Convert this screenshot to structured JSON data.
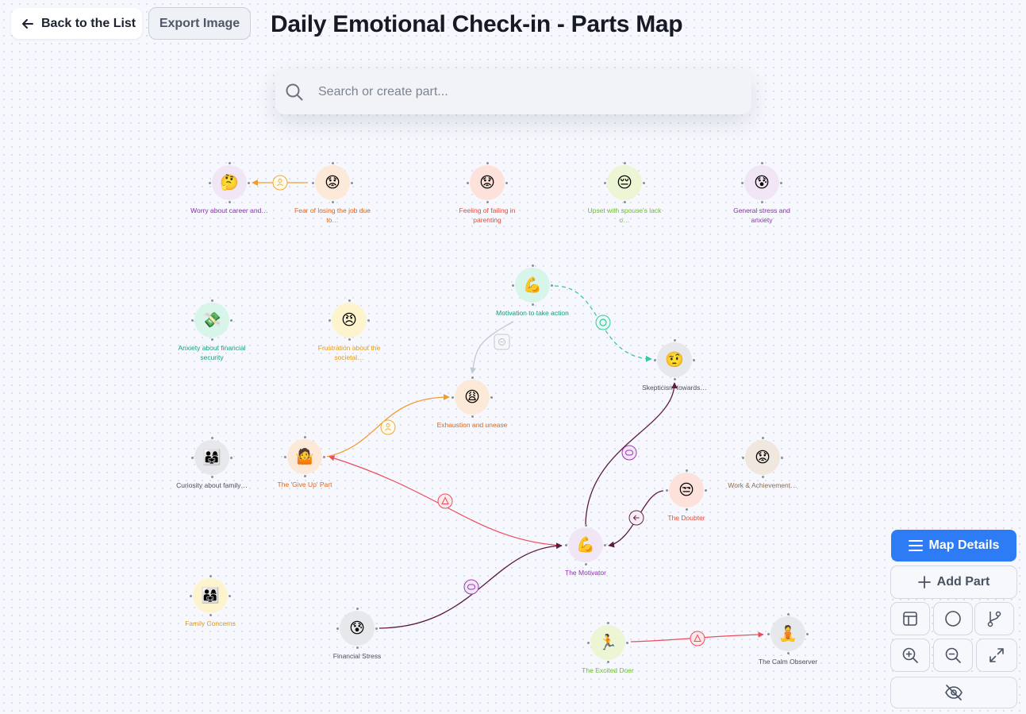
{
  "header": {
    "back_label": "Back to the List",
    "export_label": "Export Image",
    "title": "Daily Emotional Check-in - Parts Map"
  },
  "search": {
    "placeholder": "Search or create part..."
  },
  "controls": {
    "map_details_label": "Map Details",
    "add_part_label": "Add Part",
    "accent_color": "#2e7bf6"
  },
  "parts": [
    {
      "id": "worry",
      "emoji": "🤔",
      "label": "Worry about career and…",
      "color": "#8e2fb2",
      "bg": "#f1e6f5"
    },
    {
      "id": "fear",
      "emoji": "😟",
      "label": "Fear of losing the job due to…",
      "color": "#e0651a",
      "bg": "#fde9d7"
    },
    {
      "id": "failing",
      "emoji": "😟",
      "label": "Feeling of failing in parenting",
      "color": "#e24d3b",
      "bg": "#fde1db"
    },
    {
      "id": "upset",
      "emoji": "😔",
      "label": "Upset with spouse's lack o…",
      "color": "#6cbf2a",
      "bg": "#ecf6d5"
    },
    {
      "id": "stress",
      "emoji": "😰",
      "label": "General stress and anxiety",
      "color": "#8e2fb2",
      "bg": "#f1e6f5"
    },
    {
      "id": "motivation",
      "emoji": "💪",
      "label": "Motivation to take action",
      "color": "#169f7e",
      "bg": "#d8f5ea"
    },
    {
      "id": "anxiety",
      "emoji": "💸",
      "label": "Anxiety about financial security",
      "color": "#169f7e",
      "bg": "#d8f5ea"
    },
    {
      "id": "frustration",
      "emoji": "😠",
      "label": "Frustration about the societal…",
      "color": "#e39a12",
      "bg": "#fdf3cc"
    },
    {
      "id": "skepticism",
      "emoji": "🤨",
      "label": "Skepticism towards…",
      "color": "#4a4f59",
      "bg": "#e6e8ec"
    },
    {
      "id": "exhaustion",
      "emoji": "😩",
      "label": "Exhaustion and unease",
      "color": "#e0651a",
      "bg": "#fde9d7"
    },
    {
      "id": "curiosity",
      "emoji": "👨‍👩‍👧",
      "label": "Curiosity about family…",
      "color": "#4a4f59",
      "bg": "#e6e8ec"
    },
    {
      "id": "giveup",
      "emoji": "🤷",
      "label": "The 'Give Up' Part",
      "color": "#e0651a",
      "bg": "#fde9d7"
    },
    {
      "id": "work",
      "emoji": "😟",
      "label": "Work & Achievement…",
      "color": "#8d6b4c",
      "bg": "#f0e8df"
    },
    {
      "id": "doubter",
      "emoji": "😒",
      "label": "The Doubter",
      "color": "#e24d3b",
      "bg": "#fde1db"
    },
    {
      "id": "motivator",
      "emoji": "💪",
      "label": "The Motivator",
      "color": "#8e2fb2",
      "bg": "#f1e6f5"
    },
    {
      "id": "family",
      "emoji": "👨‍👩‍👧",
      "label": "Family Concerns",
      "color": "#e39a12",
      "bg": "#fdf3cc"
    },
    {
      "id": "financial",
      "emoji": "😰",
      "label": "Financial Stress",
      "color": "#4a4f59",
      "bg": "#e6e8ec"
    },
    {
      "id": "doer",
      "emoji": "🏃",
      "label": "The Excited Doer",
      "color": "#6cbf2a",
      "bg": "#ecf6d5"
    },
    {
      "id": "calm",
      "emoji": "🧘",
      "label": "The Calm Observer",
      "color": "#4a4f59",
      "bg": "#e6e8ec"
    }
  ]
}
